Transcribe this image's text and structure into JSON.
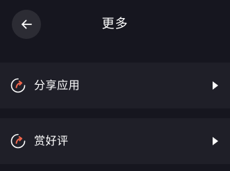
{
  "header": {
    "title": "更多",
    "back_icon": "arrow-left-icon"
  },
  "menu": {
    "items": [
      {
        "label": "分享应用",
        "icon": "refresh-arrow-icon",
        "trailing_icon": "play-arrow-icon"
      },
      {
        "label": "赏好评",
        "icon": "refresh-arrow-icon",
        "trailing_icon": "play-arrow-icon"
      }
    ]
  },
  "colors": {
    "background": "#16161f",
    "row_background": "#1f1f28",
    "back_button_background": "#2c2c34",
    "icon_accent": "#f0664d",
    "icon_ring": "#ffffff",
    "text": "#ffffff"
  }
}
